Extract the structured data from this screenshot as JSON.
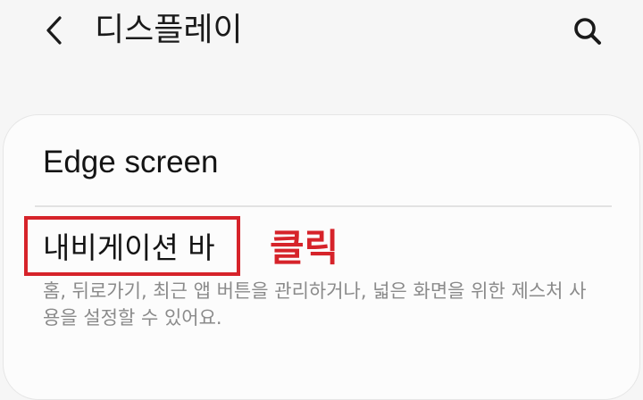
{
  "header": {
    "title": "디스플레이",
    "back_icon": "chevron-left-icon",
    "search_icon": "search-icon"
  },
  "settings": {
    "edge_screen": {
      "title": "Edge screen"
    },
    "navigation_bar": {
      "title": "내비게이션 바",
      "description": "홈, 뒤로가기, 최근 앱 버튼을 관리하거나, 넓은 화면을 위한 제스처 사용을 설정할 수 있어요."
    }
  },
  "annotation": {
    "label": "클릭",
    "color": "#d6232a"
  }
}
